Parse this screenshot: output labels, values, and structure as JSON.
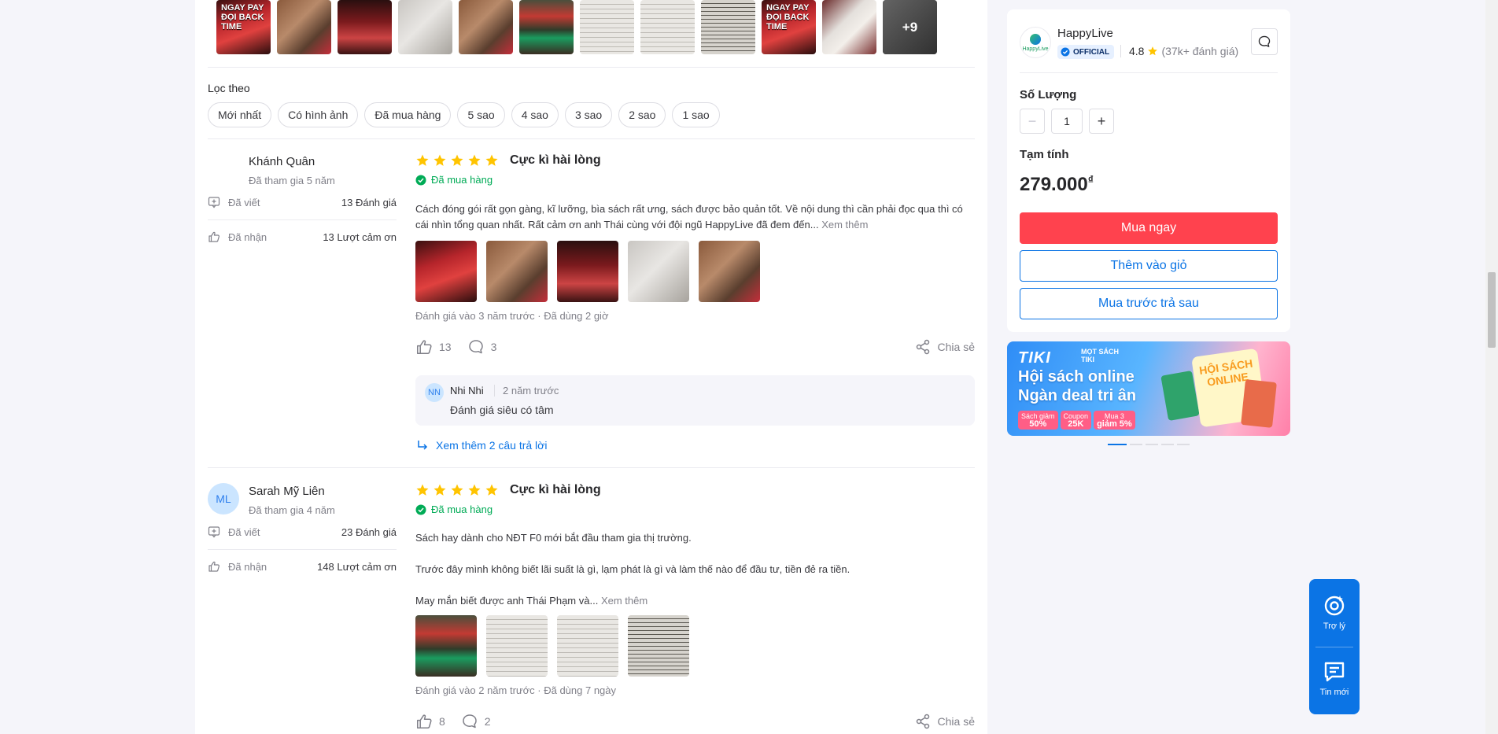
{
  "gallery": {
    "thumbs": [
      {
        "style": "red-cover",
        "text": "NGAY PAY ĐỌI BACK TIME"
      },
      {
        "style": "wood"
      },
      {
        "style": "man-cover"
      },
      {
        "style": "paper"
      },
      {
        "style": "wood"
      },
      {
        "style": "stack"
      },
      {
        "style": "page"
      },
      {
        "style": "page"
      },
      {
        "style": "page-dark"
      },
      {
        "style": "red-cover",
        "text": "NGAY PAY ĐỌI BACK TIME"
      },
      {
        "style": "hand"
      }
    ],
    "more_label": "+9"
  },
  "filter": {
    "title": "Lọc theo",
    "chips": [
      "Mới nhất",
      "Có hình ảnh",
      "Đã mua hàng",
      "5 sao",
      "4 sao",
      "3 sao",
      "2 sao",
      "1 sao"
    ]
  },
  "reviews": [
    {
      "avatar_initials": "",
      "author": "Khánh Quân",
      "joined": "Đã tham gia 5 năm",
      "written_label": "Đã viết",
      "written_value": "13 Đánh giá",
      "received_label": "Đã nhận",
      "received_value": "13 Lượt cảm ơn",
      "rating": 5,
      "rating_title": "Cực kì hài lòng",
      "bought_label": "Đã mua hàng",
      "text": " Cách đóng gói rất gọn gàng, kĩ lưỡng, bìa sách rất ưng, sách được bảo quản tốt. Về nội dung thì cần phải đọc qua thì có cái nhìn tổng quan nhất. Rất cảm ơn anh Thái cùng với đội ngũ HappyLive đã đem đến...",
      "more_label": "Xem thêm",
      "photos": [
        "red-cover",
        "wood",
        "man-cover",
        "paper",
        "wood"
      ],
      "meta_date": "Đánh giá vào 3 năm trước",
      "meta_used": "Đã dùng 2 giờ",
      "likes": "13",
      "comments": "3",
      "share_label": "Chia sẻ",
      "reply": {
        "initials": "NN",
        "name": "Nhi Nhi",
        "time": "2 năm trước",
        "text": "Đánh giá siêu có tâm"
      },
      "more_replies_label": "Xem thêm 2 câu trả lời"
    },
    {
      "avatar_initials": "ML",
      "author": "Sarah Mỹ Liên",
      "joined": "Đã tham gia 4 năm",
      "written_label": "Đã viết",
      "written_value": "23 Đánh giá",
      "received_label": "Đã nhận",
      "received_value": "148 Lượt cảm ơn",
      "rating": 5,
      "rating_title": "Cực kì hài lòng",
      "bought_label": "Đã mua hàng",
      "text_lines": [
        " Sách hay dành cho NĐT F0 mới bắt đầu tham gia thị trường.",
        "Trước đây mình không biết lãi suất là gì, lạm phát là gì và làm thế nào để đầu tư, tiền đẻ ra tiền.",
        "May mắn biết được anh Thái Phạm và..."
      ],
      "more_label": "Xem thêm",
      "photos": [
        "stack",
        "page",
        "page",
        "page-dark"
      ],
      "meta_date": "Đánh giá vào 2 năm trước",
      "meta_used": "Đã dùng 7 ngày",
      "likes": "8",
      "comments": "2",
      "share_label": "Chia sẻ"
    }
  ],
  "seller": {
    "logo_text": "HappyLive",
    "name": "HappyLive",
    "badge": "OFFICIAL",
    "rating": "4.8",
    "rating_count": "(37k+ đánh giá)"
  },
  "purchase": {
    "qty_label": "Số Lượng",
    "qty_value": "1",
    "minus": "−",
    "plus": "+",
    "subtotal_label": "Tạm tính",
    "price": "279.000",
    "currency": "₫",
    "buy_now": "Mua ngay",
    "add_cart": "Thêm vào giỏ",
    "bnpl": "Mua trước trả sau"
  },
  "banner": {
    "brand": "TIKI",
    "sub_line1": "MỌT SÁCH",
    "sub_line2": "TIKI",
    "line1": "Hội sách online",
    "line2": "Ngàn deal tri ân",
    "online_line1": "HỘI SÁCH",
    "online_line2": "ONLINE",
    "tags": [
      {
        "top": "Sách giảm",
        "big": "50%"
      },
      {
        "top": "Coupon",
        "big": "25K"
      },
      {
        "top": "Mua 3",
        "big": "giảm 5%"
      }
    ],
    "slides": 5,
    "active_slide": 0
  },
  "float": {
    "assistant": "Trợ lý",
    "messages": "Tin mới"
  },
  "colors": {
    "accent": "#0b74e5",
    "buy": "#ff424e",
    "star": "#ffc400",
    "bought": "#00ab56"
  }
}
